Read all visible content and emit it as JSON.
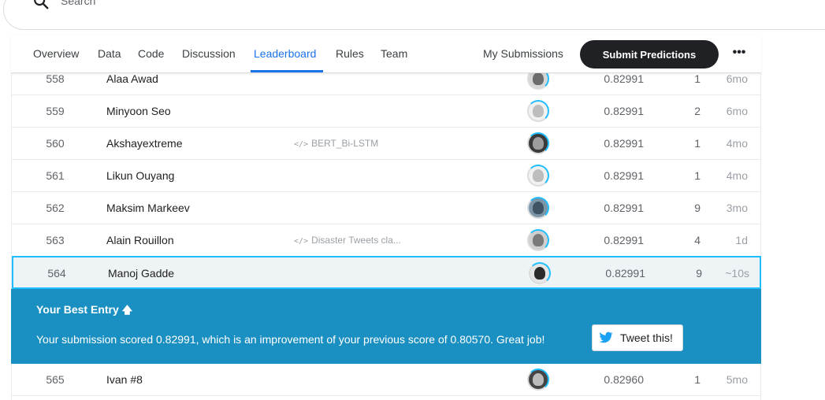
{
  "search": {
    "placeholder": "Search"
  },
  "tabs": {
    "overview": "Overview",
    "data": "Data",
    "code": "Code",
    "discussion": "Discussion",
    "leaderboard": "Leaderboard",
    "rules": "Rules",
    "team": "Team",
    "active": "Leaderboard"
  },
  "actions": {
    "my_submissions": "My Submissions",
    "submit_predictions": "Submit Predictions",
    "more": "•••"
  },
  "leaderboard": {
    "rows": [
      {
        "rank": "558",
        "team": "Alaa Awad",
        "notebook": "",
        "score": "0.82991",
        "entries": "1",
        "last": "6mo"
      },
      {
        "rank": "559",
        "team": "Minyoon Seo",
        "notebook": "",
        "score": "0.82991",
        "entries": "2",
        "last": "6mo"
      },
      {
        "rank": "560",
        "team": "Akshayextreme",
        "notebook": "BERT_Bi-LSTM",
        "score": "0.82991",
        "entries": "1",
        "last": "4mo"
      },
      {
        "rank": "561",
        "team": "Likun Ouyang",
        "notebook": "",
        "score": "0.82991",
        "entries": "1",
        "last": "4mo"
      },
      {
        "rank": "562",
        "team": "Maksim Markeev",
        "notebook": "",
        "score": "0.82991",
        "entries": "9",
        "last": "3mo"
      },
      {
        "rank": "563",
        "team": "Alain Rouillon",
        "notebook": "Disaster Tweets cla...",
        "score": "0.82991",
        "entries": "4",
        "last": "1d"
      },
      {
        "rank": "564",
        "team": "Manoj Gadde",
        "notebook": "",
        "score": "0.82991",
        "entries": "9",
        "last": "~10s"
      },
      {
        "rank": "565",
        "team": "Ivan #8",
        "notebook": "",
        "score": "0.82960",
        "entries": "1",
        "last": "5mo"
      }
    ],
    "highlight_rank": "564"
  },
  "best_entry": {
    "title": "Your Best Entry",
    "arrow": "🡅",
    "message": "Your submission scored 0.82991, which is an improvement of your previous score of 0.80570. Great job!",
    "tweet_label": "Tweet this!"
  },
  "colors": {
    "accent": "#20beff",
    "banner": "#1a8fc1",
    "tab_active": "#1a73e8",
    "submit_bg": "#202124"
  }
}
